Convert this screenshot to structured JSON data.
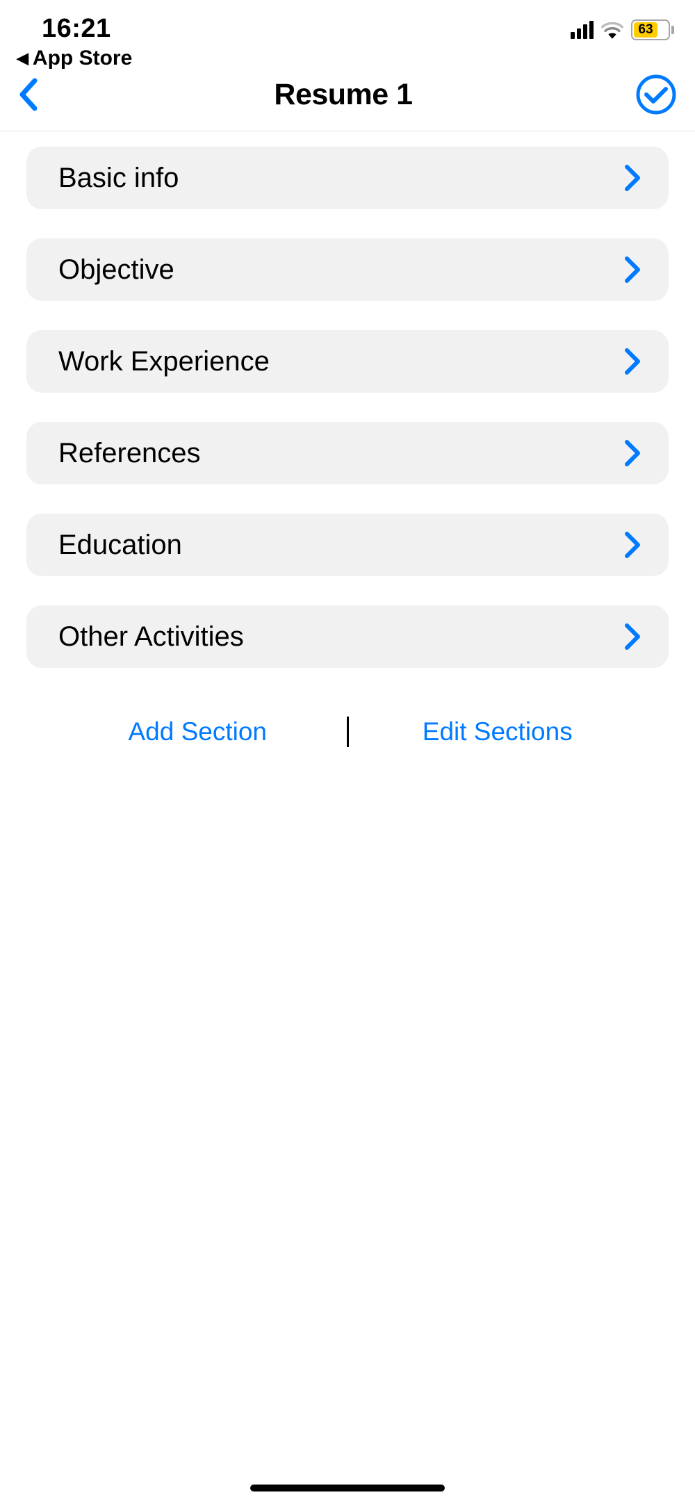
{
  "statusbar": {
    "time": "16:21",
    "breadcrumb": "App Store",
    "battery": "63"
  },
  "nav": {
    "title": "Resume 1"
  },
  "sections": [
    {
      "label": "Basic info"
    },
    {
      "label": "Objective"
    },
    {
      "label": "Work Experience"
    },
    {
      "label": "References"
    },
    {
      "label": "Education"
    },
    {
      "label": "Other Activities"
    }
  ],
  "actions": {
    "add": "Add Section",
    "edit": "Edit Sections"
  },
  "colors": {
    "accent": "#007aff",
    "row_bg": "#f1f1f1",
    "battery_fill": "#ffcc00"
  }
}
